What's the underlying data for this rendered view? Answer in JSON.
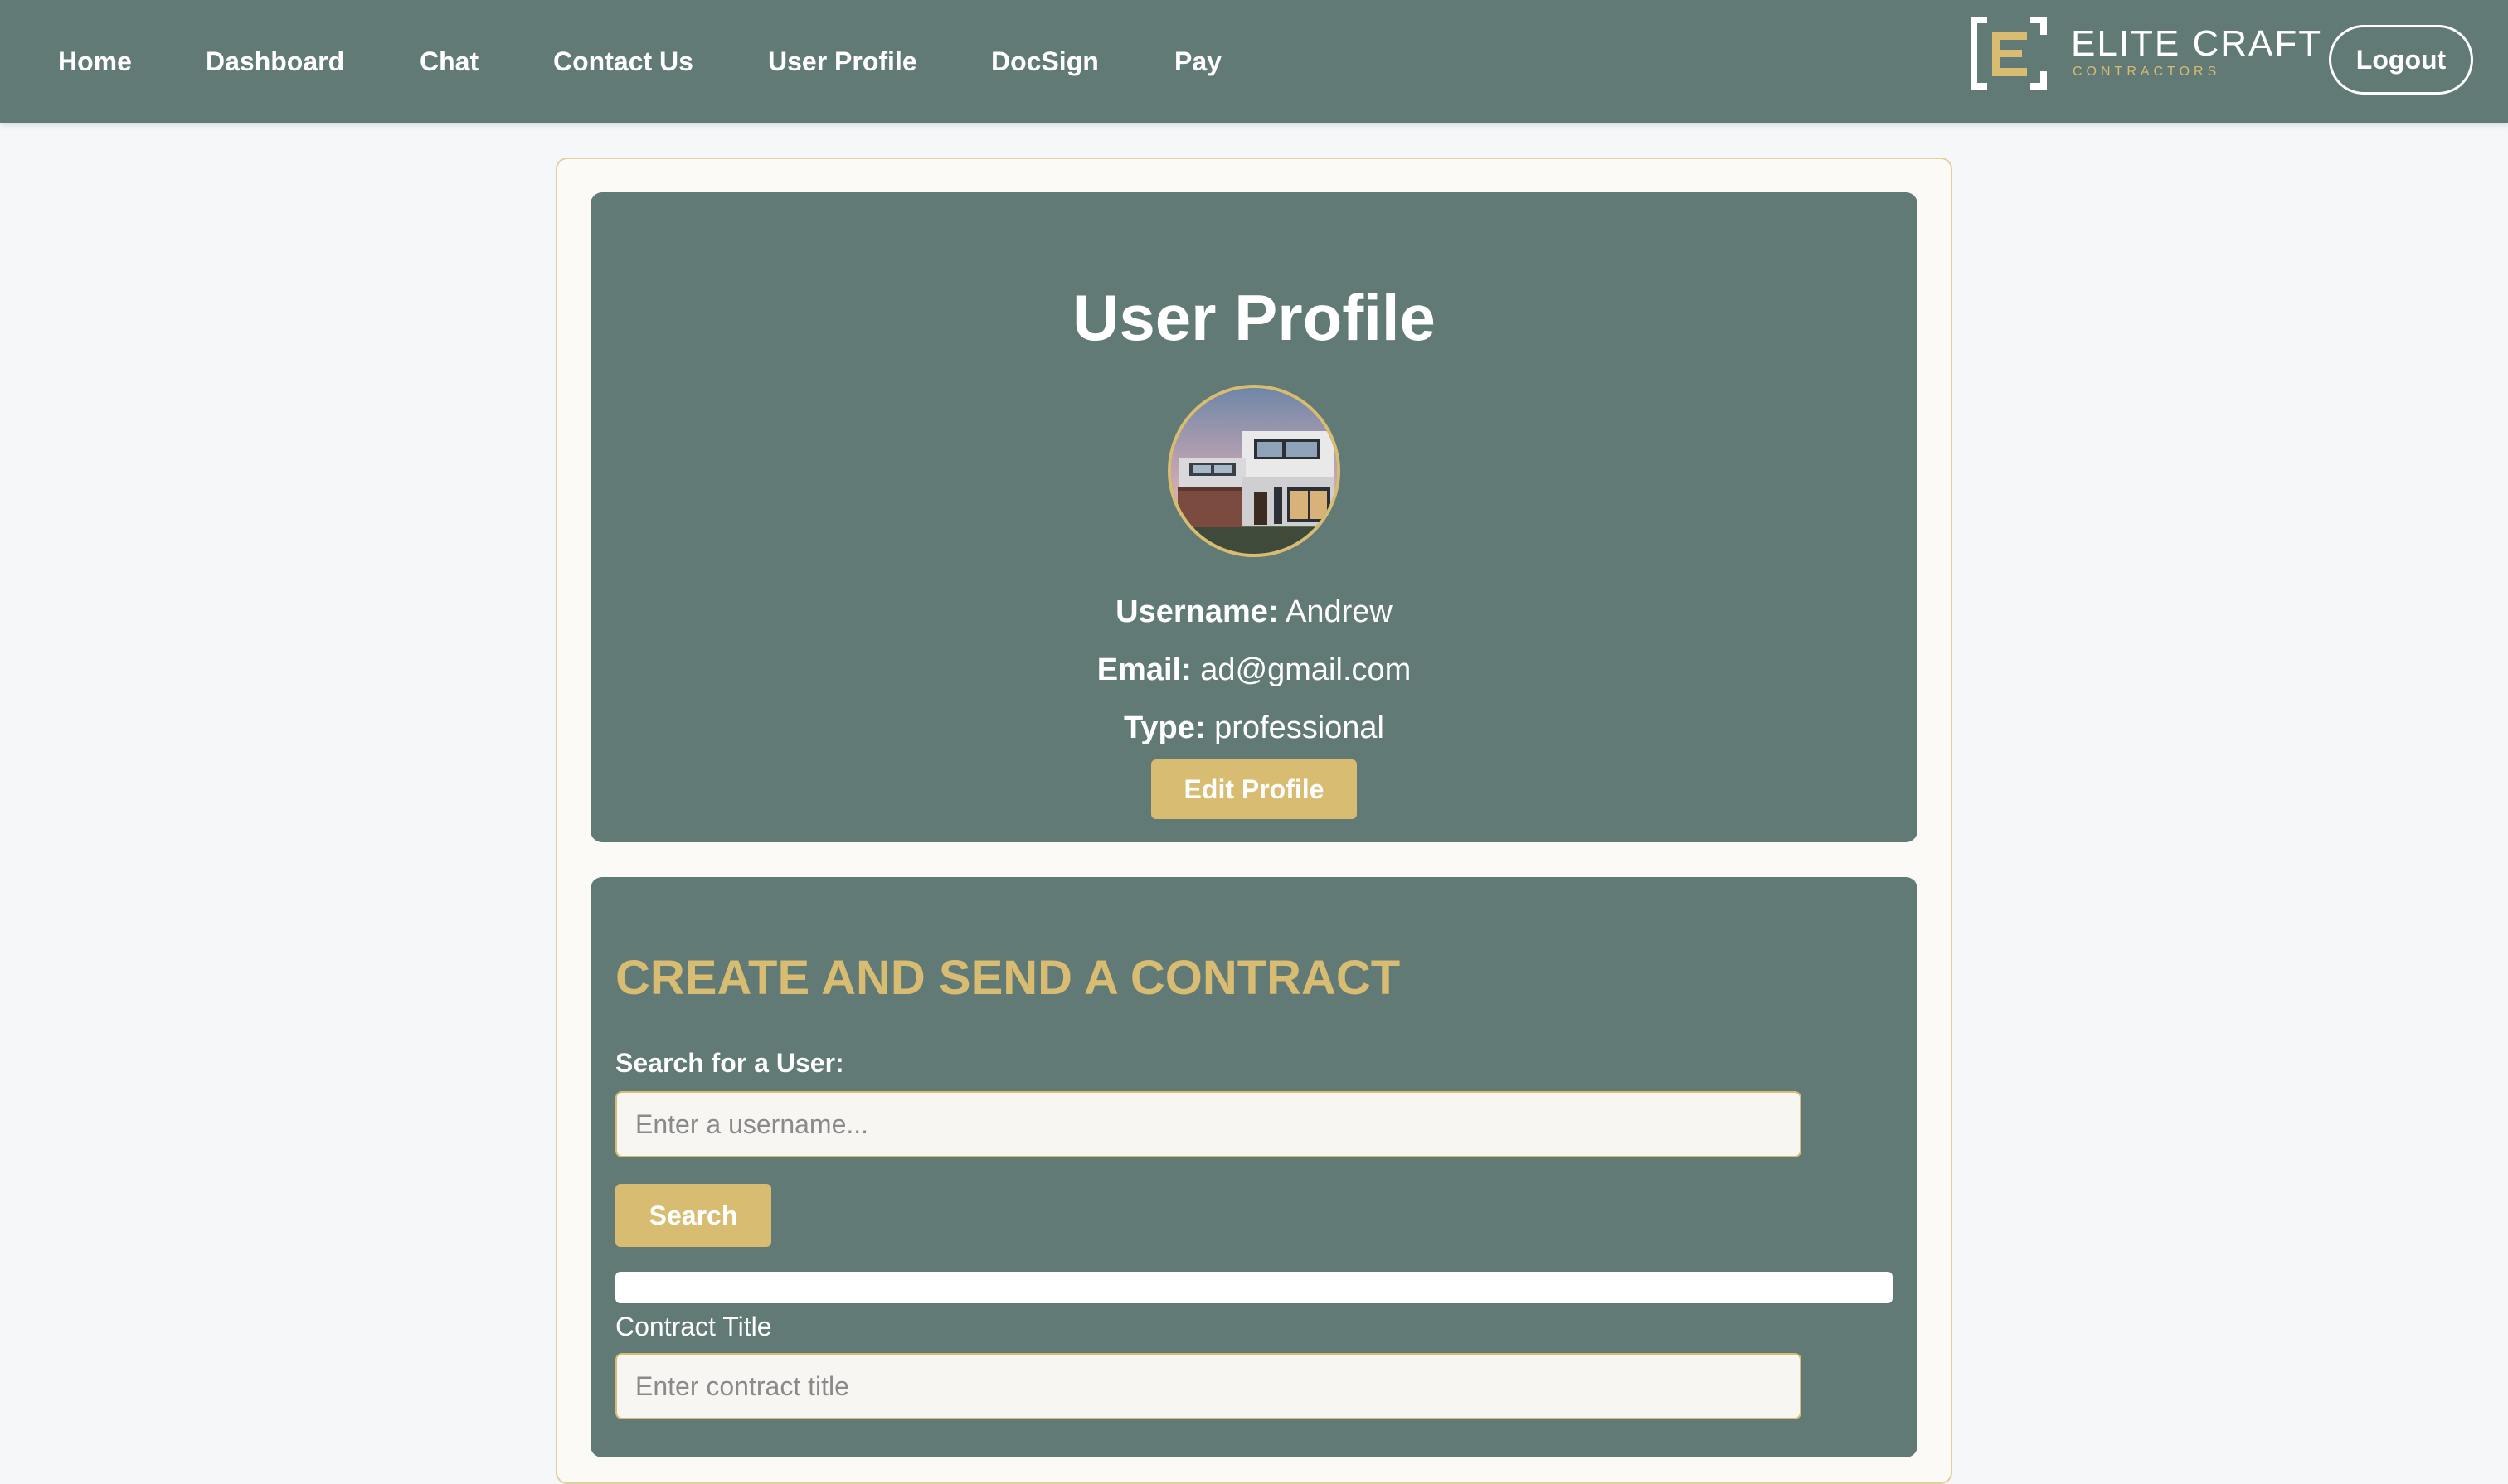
{
  "nav": {
    "items": [
      {
        "label": "Home"
      },
      {
        "label": "Dashboard"
      },
      {
        "label": "Chat"
      },
      {
        "label": "Contact Us"
      },
      {
        "label": "User Profile"
      },
      {
        "label": "DocSign"
      },
      {
        "label": "Pay"
      }
    ],
    "logout_label": "Logout"
  },
  "brand": {
    "name": "ELITE CRAFT",
    "tagline": "CONTRACTORS",
    "accent_color": "#d8bc72",
    "primary_color": "#627a76"
  },
  "profile": {
    "title": "User Profile",
    "avatar_icon": "house-photo",
    "username_label": "Username:",
    "username": "Andrew",
    "email_label": "Email:",
    "email": "ad@gmail.com",
    "type_label": "Type:",
    "type": "professional",
    "edit_label": "Edit Profile"
  },
  "contract": {
    "title": "CREATE AND SEND A CONTRACT",
    "search_label": "Search for a User:",
    "search_placeholder": "Enter a username...",
    "search_button": "Search",
    "contract_title_label": "Contract Title",
    "contract_title_placeholder": "Enter contract title"
  }
}
